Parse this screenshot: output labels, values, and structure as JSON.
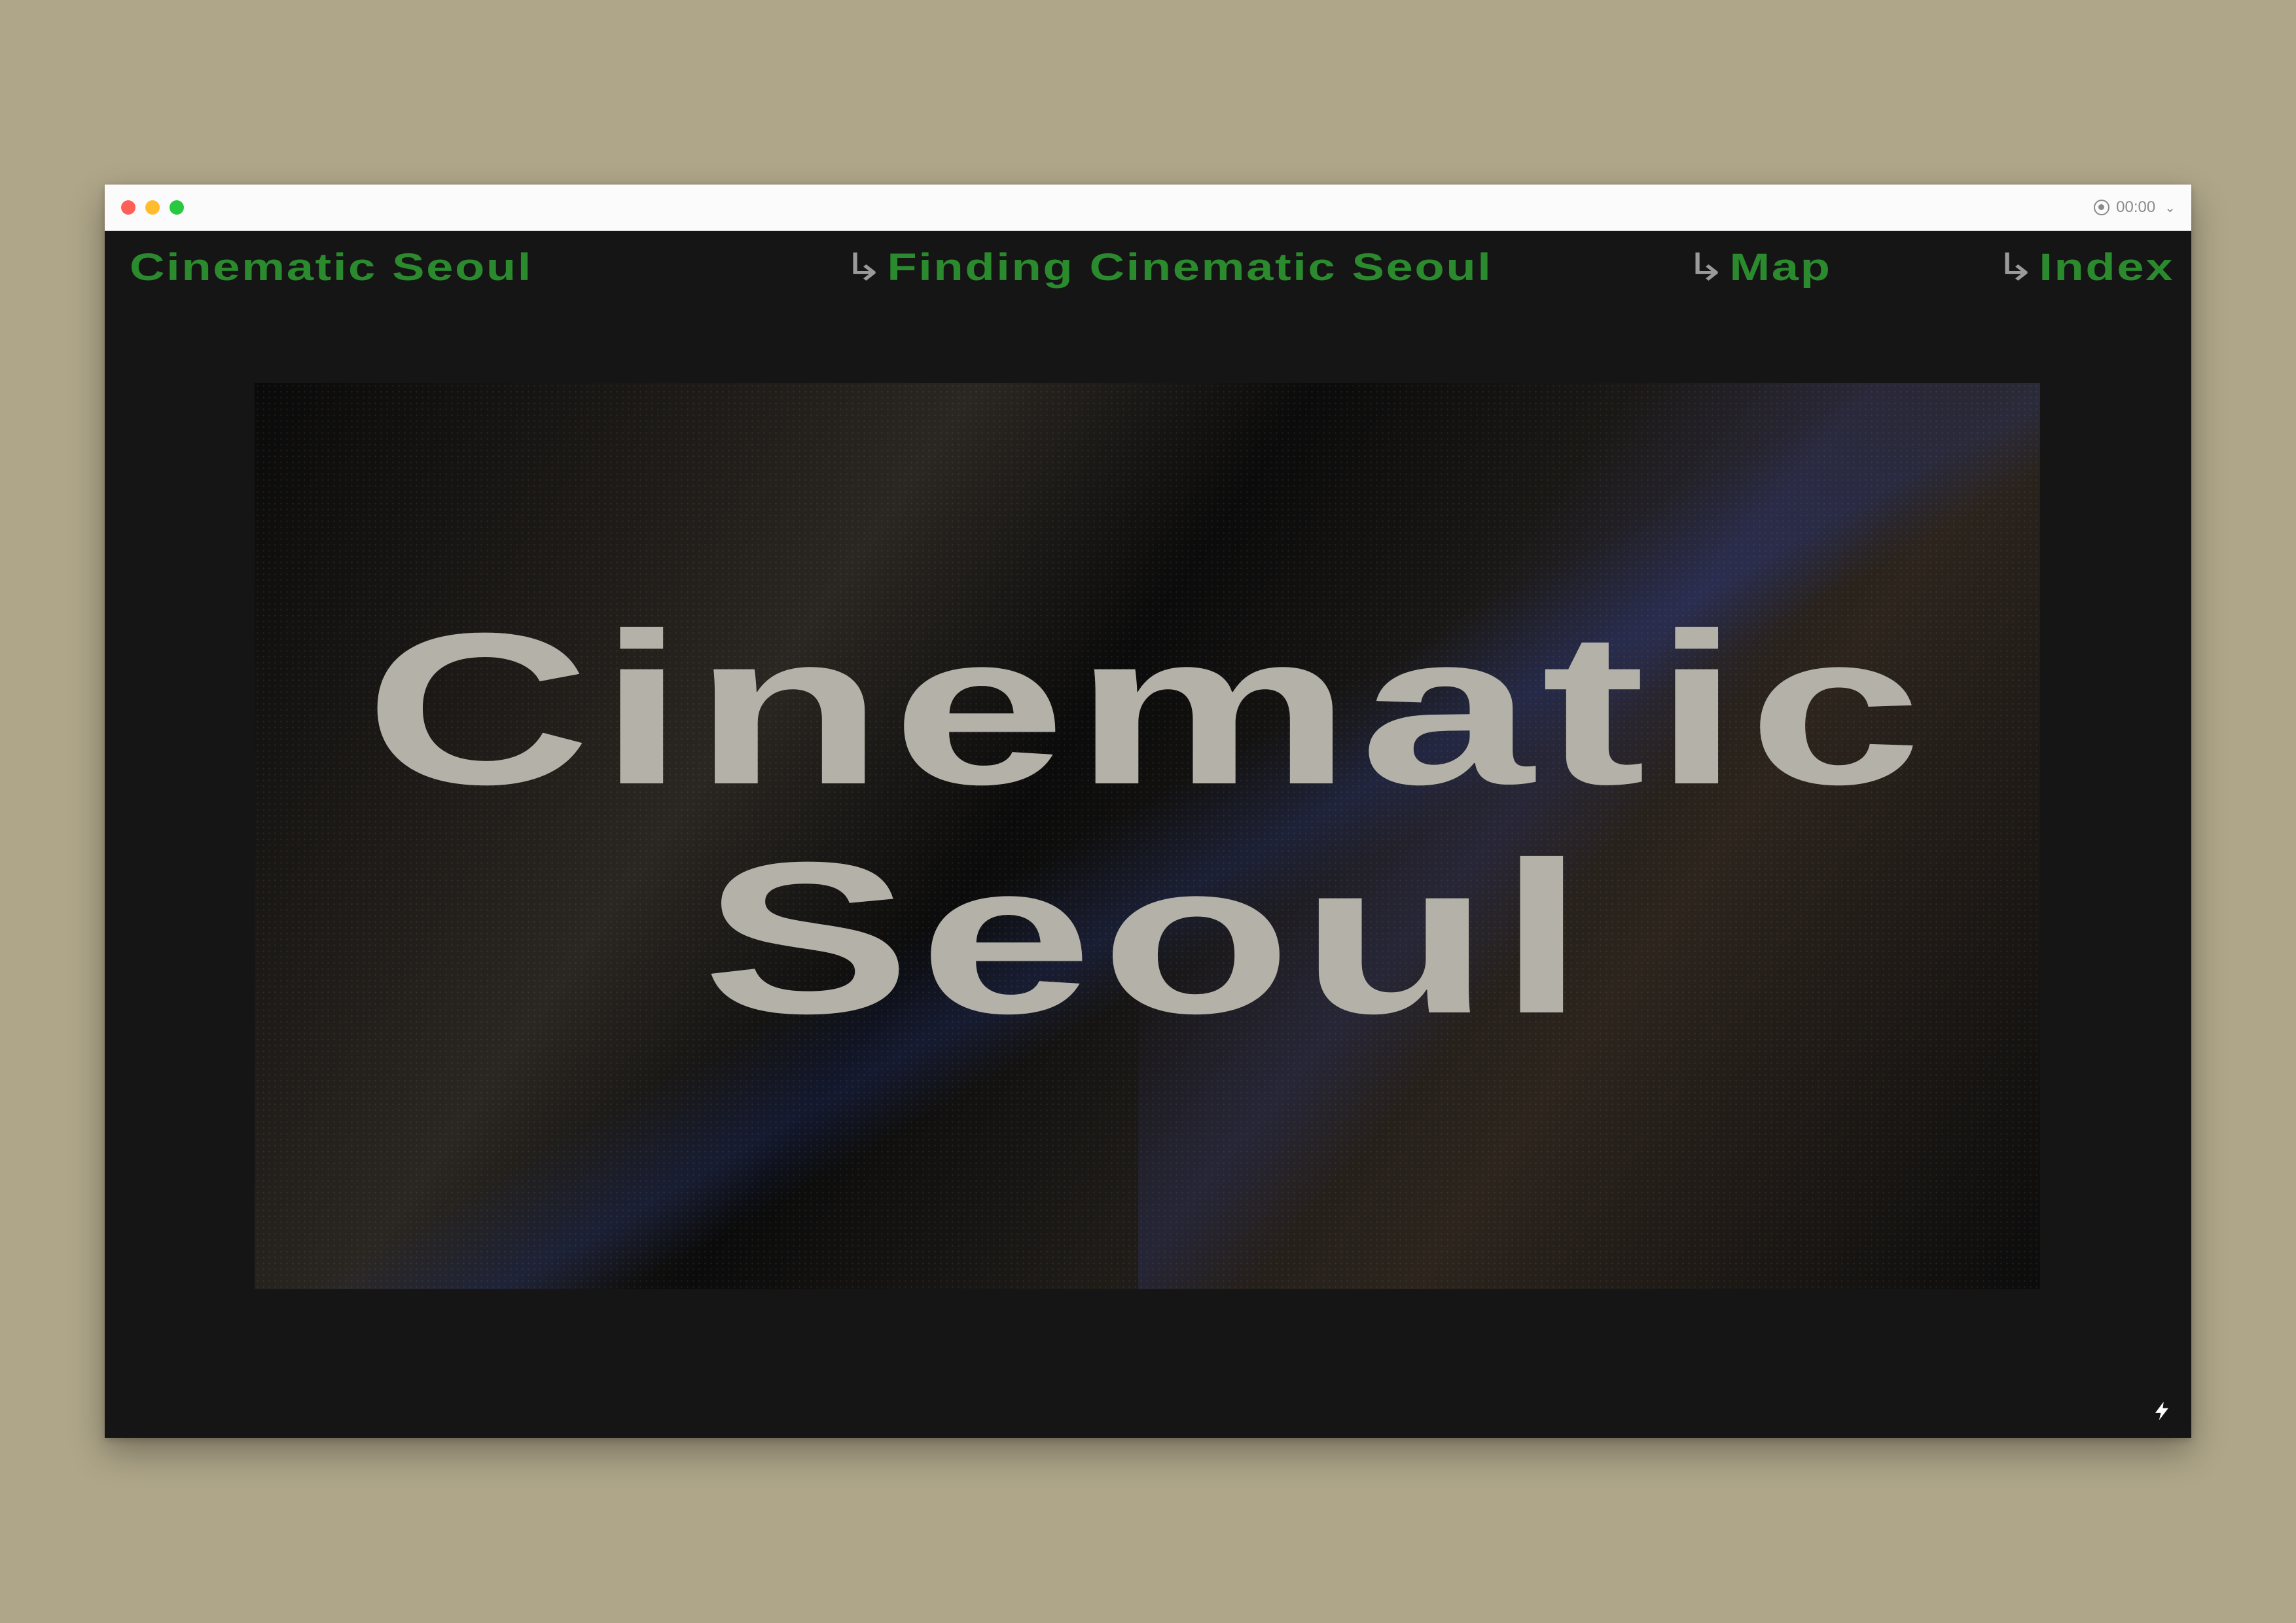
{
  "recording": {
    "time": "00:00"
  },
  "nav": {
    "home": "Cinematic Seoul",
    "finding": "Finding Cinematic Seoul",
    "map": "Map",
    "index": "Index",
    "arrow": "↳"
  },
  "hero": {
    "line1": "Cinematic",
    "line2": "Seoul"
  },
  "colors": {
    "nav_text": "#2a8a2d",
    "page_background": "#151515",
    "hero_text": "#b4b2a8",
    "desk_background": "#afa689"
  },
  "icons": {
    "record": "record-icon",
    "chevron": "chevron-down-icon",
    "lightning": "lightning-icon"
  }
}
